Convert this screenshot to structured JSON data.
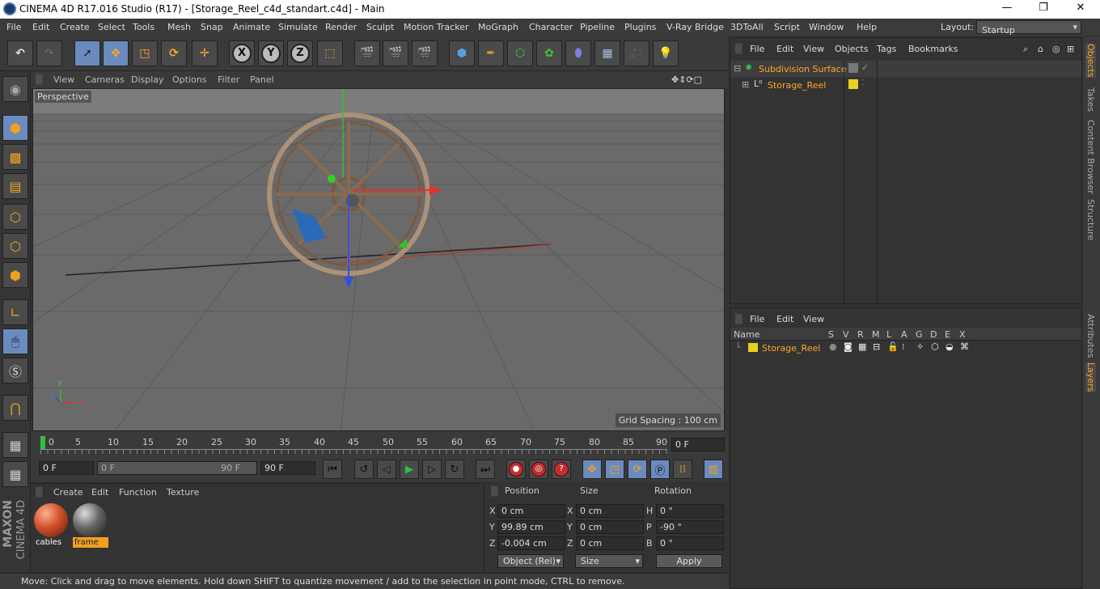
{
  "window": {
    "title": "CINEMA 4D R17.016 Studio (R17) - [Storage_Reel_c4d_standart.c4d] - Main",
    "minimize": "—",
    "maximize": "❐",
    "close": "✕"
  },
  "menu": {
    "items": [
      "File",
      "Edit",
      "Create",
      "Select",
      "Tools",
      "Mesh",
      "Snap",
      "Animate",
      "Simulate",
      "Render",
      "Sculpt",
      "Motion Tracker",
      "MoGraph",
      "Character",
      "Pipeline",
      "Plugins",
      "V-Ray Bridge",
      "3DToAll",
      "Script",
      "Window",
      "Help"
    ],
    "layout_label": "Layout:",
    "layout_value": "Startup"
  },
  "toolbar": {
    "axis_x": "X",
    "axis_y": "Y",
    "axis_z": "Z"
  },
  "viewport": {
    "menu": [
      "View",
      "Cameras",
      "Display",
      "Options",
      "Filter",
      "Panel"
    ],
    "label": "Perspective",
    "grid_spacing": "Grid Spacing : 100 cm",
    "axis_x": "X",
    "axis_y": "Y",
    "axis_z": "Z"
  },
  "timeline": {
    "ticks": [
      "0",
      "5",
      "10",
      "15",
      "20",
      "25",
      "30",
      "35",
      "40",
      "45",
      "50",
      "55",
      "60",
      "65",
      "70",
      "75",
      "80",
      "85",
      "90"
    ],
    "current": "0 F"
  },
  "playback": {
    "start": "0 F",
    "range_start": "0 F",
    "range_end": "90 F",
    "end": "90 F"
  },
  "materials": {
    "menu": [
      "Create",
      "Edit",
      "Function",
      "Texture"
    ],
    "items": [
      {
        "name": "cables",
        "color": "#d0502a"
      },
      {
        "name": "frame",
        "color": "#666666"
      }
    ]
  },
  "coords": {
    "headers": {
      "position": "Position",
      "size": "Size",
      "rotation": "Rotation"
    },
    "rows": [
      {
        "axis": "X",
        "pos": "0 cm",
        "size_axis": "X",
        "size": "0 cm",
        "rot_axis": "H",
        "rot": "0 °"
      },
      {
        "axis": "Y",
        "pos": "99.89 cm",
        "size_axis": "Y",
        "size": "0 cm",
        "rot_axis": "P",
        "rot": "-90 °"
      },
      {
        "axis": "Z",
        "pos": "-0.004 cm",
        "size_axis": "Z",
        "size": "0 cm",
        "rot_axis": "B",
        "rot": "0 °"
      }
    ],
    "mode": "Object (Rel)",
    "size_mode": "Size",
    "apply": "Apply"
  },
  "status": "Move: Click and drag to move elements. Hold down SHIFT to quantize movement / add to the selection in point mode, CTRL to remove.",
  "objects": {
    "menu": [
      "File",
      "Edit",
      "View",
      "Objects",
      "Tags",
      "Bookmarks"
    ],
    "items": [
      {
        "name": "Subdivision Surface",
        "color": "#ffa726"
      },
      {
        "name": "Storage_Reel",
        "color": "#ffa726"
      }
    ]
  },
  "layers": {
    "menu": [
      "File",
      "Edit",
      "View"
    ],
    "columns": [
      "Name",
      "S",
      "V",
      "R",
      "M",
      "L",
      "A",
      "G",
      "D",
      "E",
      "X"
    ],
    "items": [
      {
        "name": "Storage_Reel",
        "color": "#e8d020"
      }
    ]
  },
  "right_tabs": [
    "Objects",
    "Takes",
    "Content Browser",
    "Structure",
    "Attributes",
    "Layers"
  ],
  "brand": {
    "maxon": "MAXON",
    "product": "CINEMA 4D"
  }
}
